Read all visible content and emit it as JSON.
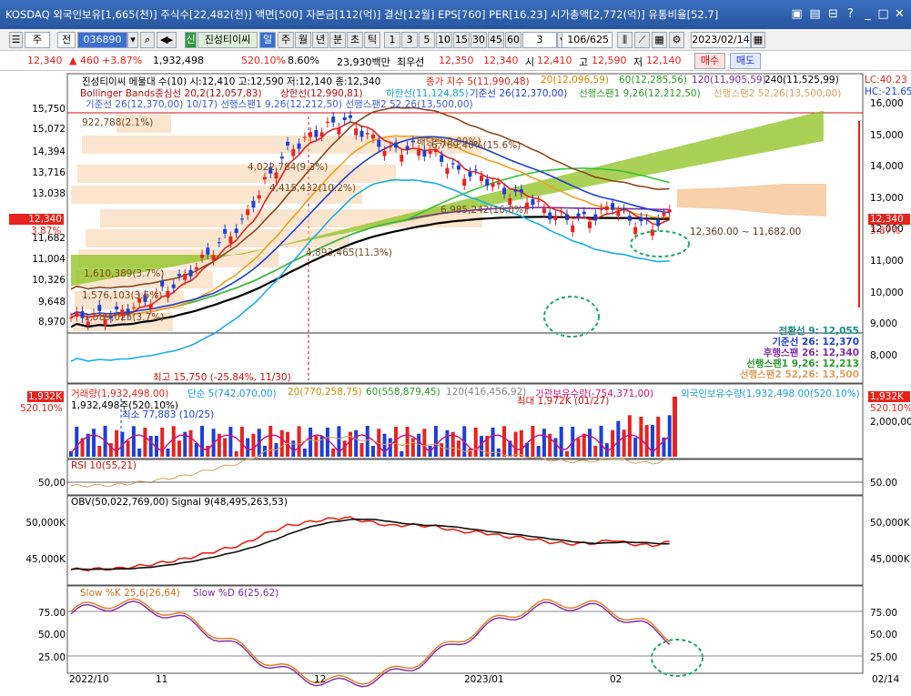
{
  "title_bar": {
    "text": "KOSDAQ 외국인보유[1,665(천)] 주식수[22,482(천)] 액면[500] 자본금[112(억)] 결산[12월] EPS[760] PER[16.23] 시가총액[2,772(억)] 유통비율[52.7]"
  },
  "toolbar": {
    "type1": "주",
    "type2": "전",
    "code": "036890",
    "name_badge": "진성티이씨",
    "periods": [
      "일",
      "주",
      "월",
      "년",
      "분",
      "초",
      "틱"
    ],
    "minutes": [
      "1",
      "3",
      "5",
      "10",
      "15",
      "30",
      "45",
      "60"
    ],
    "interval": "3",
    "count": "106/625",
    "date": "2023/02/14"
  },
  "quote": {
    "price": "12,340",
    "change": "▲ 460",
    "change_pct": "+3.87%",
    "volume": "1,932,498",
    "volume_ratio": "520.10%",
    "turnover": "8.60%",
    "amount": "23,930백만",
    "best_ask_label": "최우선",
    "best_ask": "12,350",
    "best_bid": "12,340",
    "open_label": "시",
    "open": "12,410",
    "high_label": "고",
    "high": "12,590",
    "low_label": "저",
    "low": "12,140",
    "buy_button": "매수",
    "sell_button": "매도"
  },
  "price_pane": {
    "header1": "진성티이씨 메물대 수(10)  시:12,410 고:12,590 저:12,140 종:12,340",
    "ma_legend": [
      "종가 지수 5(11,990,48)",
      "20(12,096,59)",
      "60(12,285,56)",
      "120(11,905,59)",
      "240(11,525,99)"
    ],
    "bb_legend": [
      "Bollinger Bands중심선 20,2(12,057,83)",
      "상한선(12,990,81)",
      "하한선(11,124,85)",
      "기준선 26(12,370,00)",
      "선행스팬1 9,26(12,212,50)",
      "선행스팬2 52,26(13,500,00)"
    ],
    "ichimoku_extra": "기준선 26(12,370,00)  10/17)  선행스팬1 9,26(12,212,50)  선행스팬2 52,26(13,500,00)",
    "left_axis": [
      "15,750",
      "15,072",
      "14,394",
      "13,716",
      "13,038",
      "12,340",
      "11,682",
      "11,004",
      "10,326",
      "9,648",
      "8,970"
    ],
    "right_axis": [
      "16,000",
      "15,000",
      "14,000",
      "13,000",
      "12,000",
      "11,000",
      "10,000",
      "9,000",
      "8,000"
    ],
    "current_price_tag": "12,340",
    "current_pct_tag": "3.87%",
    "lc_label": "LC:40.23",
    "hc_label": "HC:-21.65",
    "annotations": [
      "922,788(2.1%)",
      "4,022,784(9.3%)",
      "4,415,432(10.2%)",
      "6,769,40%(15.6%)",
      "배당락(9.99%)",
      "6,985,242(16.0%)",
      "4,893,465(11.3%)",
      "1,610,389(3.7%)",
      "1,576,103(3.6%)",
      "1,589,025(3.7%)",
      "12,360.00 ~ 11,682.00"
    ],
    "high_note": "최고 15,750 (-25.84%, 11/30)",
    "ichimoku_box": [
      "전환선 9: 12,055",
      "기준선 26: 12,370",
      "후행스팬 26: 12,340",
      "선행스팬1 9,26: 12,213",
      "선행스팬2 52,26: 13,500"
    ]
  },
  "volume_pane": {
    "header": [
      "거래량(1,932,498.00)",
      "단순 5(742,070,00)",
      "20(770,258,75)",
      "60(558,879,45)",
      "120(416,456,92)",
      "기관보유수량(-754,371,00)",
      "외국인보유수량(1,932,498.00(520.10%)"
    ],
    "sub": "1,932,498주(520.10%)",
    "min_note": "최소 77,883 (10/25)",
    "max_note": "최대 1,972K (01/27)",
    "left_tag": "1,932K",
    "left_pct": "520.10%",
    "right_tag": "1,932K",
    "right_pct": "520.10%",
    "right_axis": "2,000,000"
  },
  "rsi_pane": {
    "header": "RSI 10(55,21)",
    "left_axis": "50,00",
    "right_axis": "50.00"
  },
  "obv_pane": {
    "header": "OBV(50,022,769,00)  Signal 9(48,495,263,53)",
    "left_axis": [
      "50,000K",
      "45,000K"
    ],
    "right_axis": [
      "50,000K",
      "45,000K"
    ]
  },
  "stoch_pane": {
    "header_k": "Slow %K 25,6(26,64)",
    "header_d": "Slow %D 6(25,62)",
    "left_axis": [
      "75.00",
      "50.00",
      "25.00"
    ],
    "right_axis": [
      "75.00",
      "50.00",
      "25.00"
    ]
  },
  "x_axis": {
    "labels": [
      "2022/10",
      "11",
      "12",
      "2023/01",
      "02"
    ],
    "right_label": "02/14"
  },
  "colors": {
    "up": "#e8231c",
    "down": "#1d3fd6",
    "kumo": "#8ec21d",
    "kumo_neg": "#f6d0a8",
    "accent": "#2755a0"
  }
}
